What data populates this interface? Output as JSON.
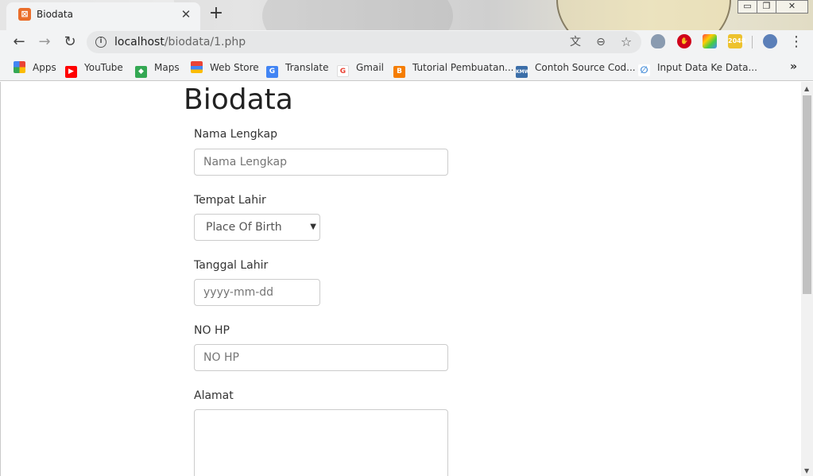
{
  "browser": {
    "tab": {
      "title": "Biodata",
      "favicon": "xampp-icon",
      "close_glyph": "✕"
    },
    "new_tab_glyph": "+",
    "window_controls": {
      "minimize": "▭",
      "restore": "❐",
      "close": "✕"
    },
    "toolbar": {
      "back_glyph": "←",
      "forward_glyph": "→",
      "reload_glyph": "↻",
      "url_host": "localhost",
      "url_path": "/biodata/1.php",
      "info_glyph": "i",
      "translate_glyph": "文",
      "zoom_glyph": "⊖",
      "star_glyph": "☆",
      "menu_glyph": "⋮"
    },
    "bookmarks": [
      {
        "label": "Apps",
        "icon": "apps-grid-icon",
        "color": "#e8453c"
      },
      {
        "label": "YouTube",
        "icon": "youtube-icon",
        "color": "#ff0000"
      },
      {
        "label": "Maps",
        "icon": "maps-icon",
        "color": "#34a853"
      },
      {
        "label": "Web Store",
        "icon": "web-store-icon",
        "color": "#4285f4"
      },
      {
        "label": "Translate",
        "icon": "translate-icon",
        "color": "#4285f4"
      },
      {
        "label": "Gmail",
        "icon": "google-icon",
        "color": "#ea4335"
      },
      {
        "label": "Tutorial Pembuatan...",
        "icon": "blogger-icon",
        "color": "#f57d00"
      },
      {
        "label": "Contoh Source Cod...",
        "icon": "kmw-icon",
        "color": "#3b6ea8"
      },
      {
        "label": "Input Data Ke Data...",
        "icon": "link-icon",
        "color": "#4a90d9"
      }
    ],
    "bookmarks_overflow": "»"
  },
  "page": {
    "title": "Biodata",
    "form": {
      "nama_label": "Nama Lengkap",
      "nama_placeholder": "Nama Lengkap",
      "tempat_label": "Tempat Lahir",
      "tempat_selected": "Place Of Birth",
      "tanggal_label": "Tanggal Lahir",
      "tanggal_placeholder": "yyyy-mm-dd",
      "hp_label": "NO HP",
      "hp_placeholder": "NO HP",
      "alamat_label": "Alamat"
    }
  }
}
